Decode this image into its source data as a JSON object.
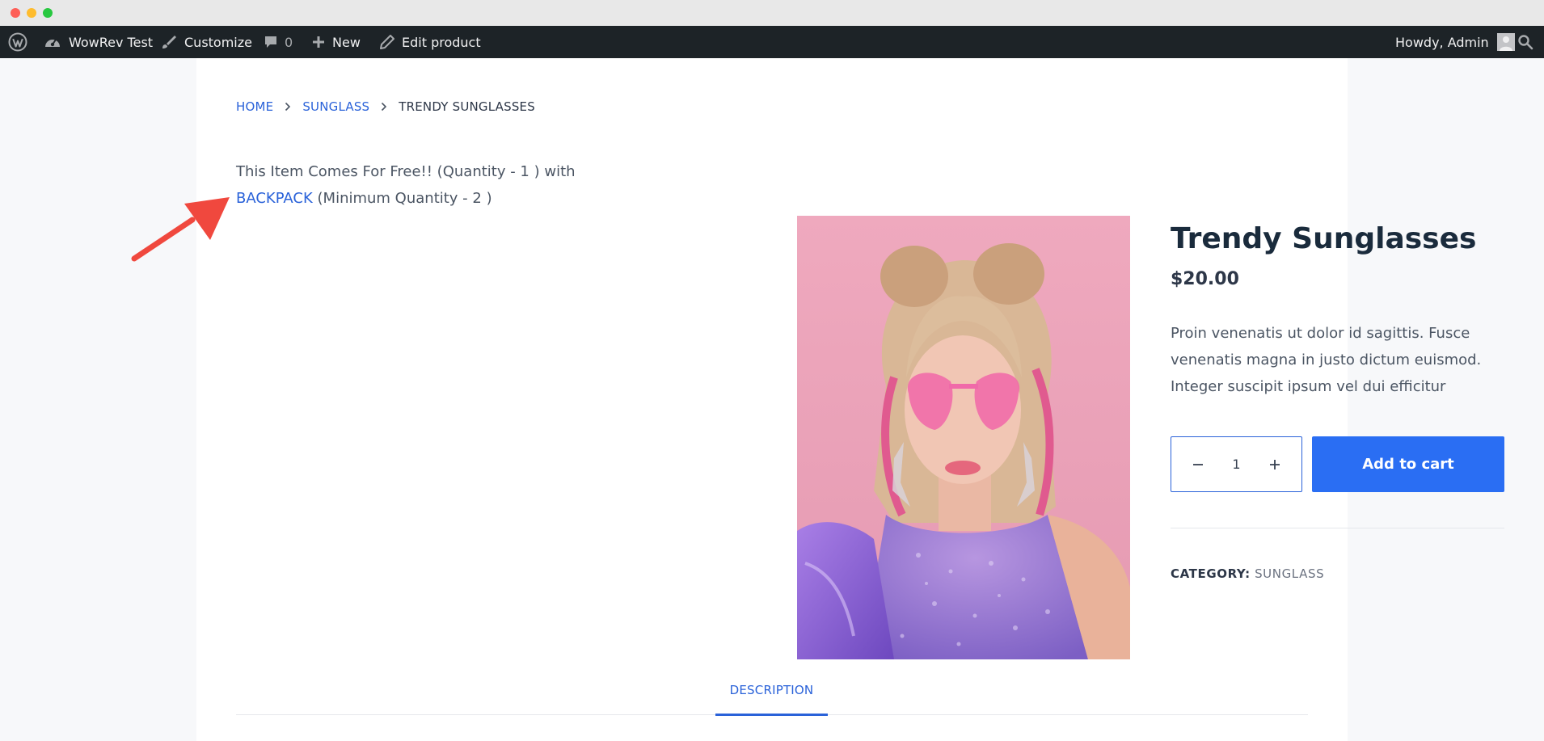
{
  "adminbar": {
    "site_name": "WowRev Test",
    "customize_label": "Customize",
    "comments_count": "0",
    "new_label": "New",
    "edit_label": "Edit product",
    "howdy_label": "Howdy, Admin"
  },
  "breadcrumb": {
    "home": "HOME",
    "category": "SUNGLASS",
    "current": "TRENDY SUNGLASSES"
  },
  "offer": {
    "text_before": "This Item Comes For Free!! (Quantity - 1 ) with",
    "link_text": "BACKPACK",
    "text_after": " (Minimum Quantity - 2 )"
  },
  "product": {
    "title": "Trendy Sunglasses",
    "price": "$20.00",
    "description": "Proin venenatis ut dolor id sagittis. Fusce venenatis magna in justo dictum euismod. Integer suscipit ipsum vel dui efficitur",
    "quantity": "1",
    "add_to_cart_label": "Add to cart",
    "category_label": "CATEGORY:",
    "category_value": "SUNGLASS"
  },
  "tabs": {
    "description": "DESCRIPTION"
  },
  "colors": {
    "accent": "#2a6ef3",
    "link": "#2a62d9",
    "adminbar_bg": "#1d2327",
    "annotation_arrow": "#f0483e"
  }
}
